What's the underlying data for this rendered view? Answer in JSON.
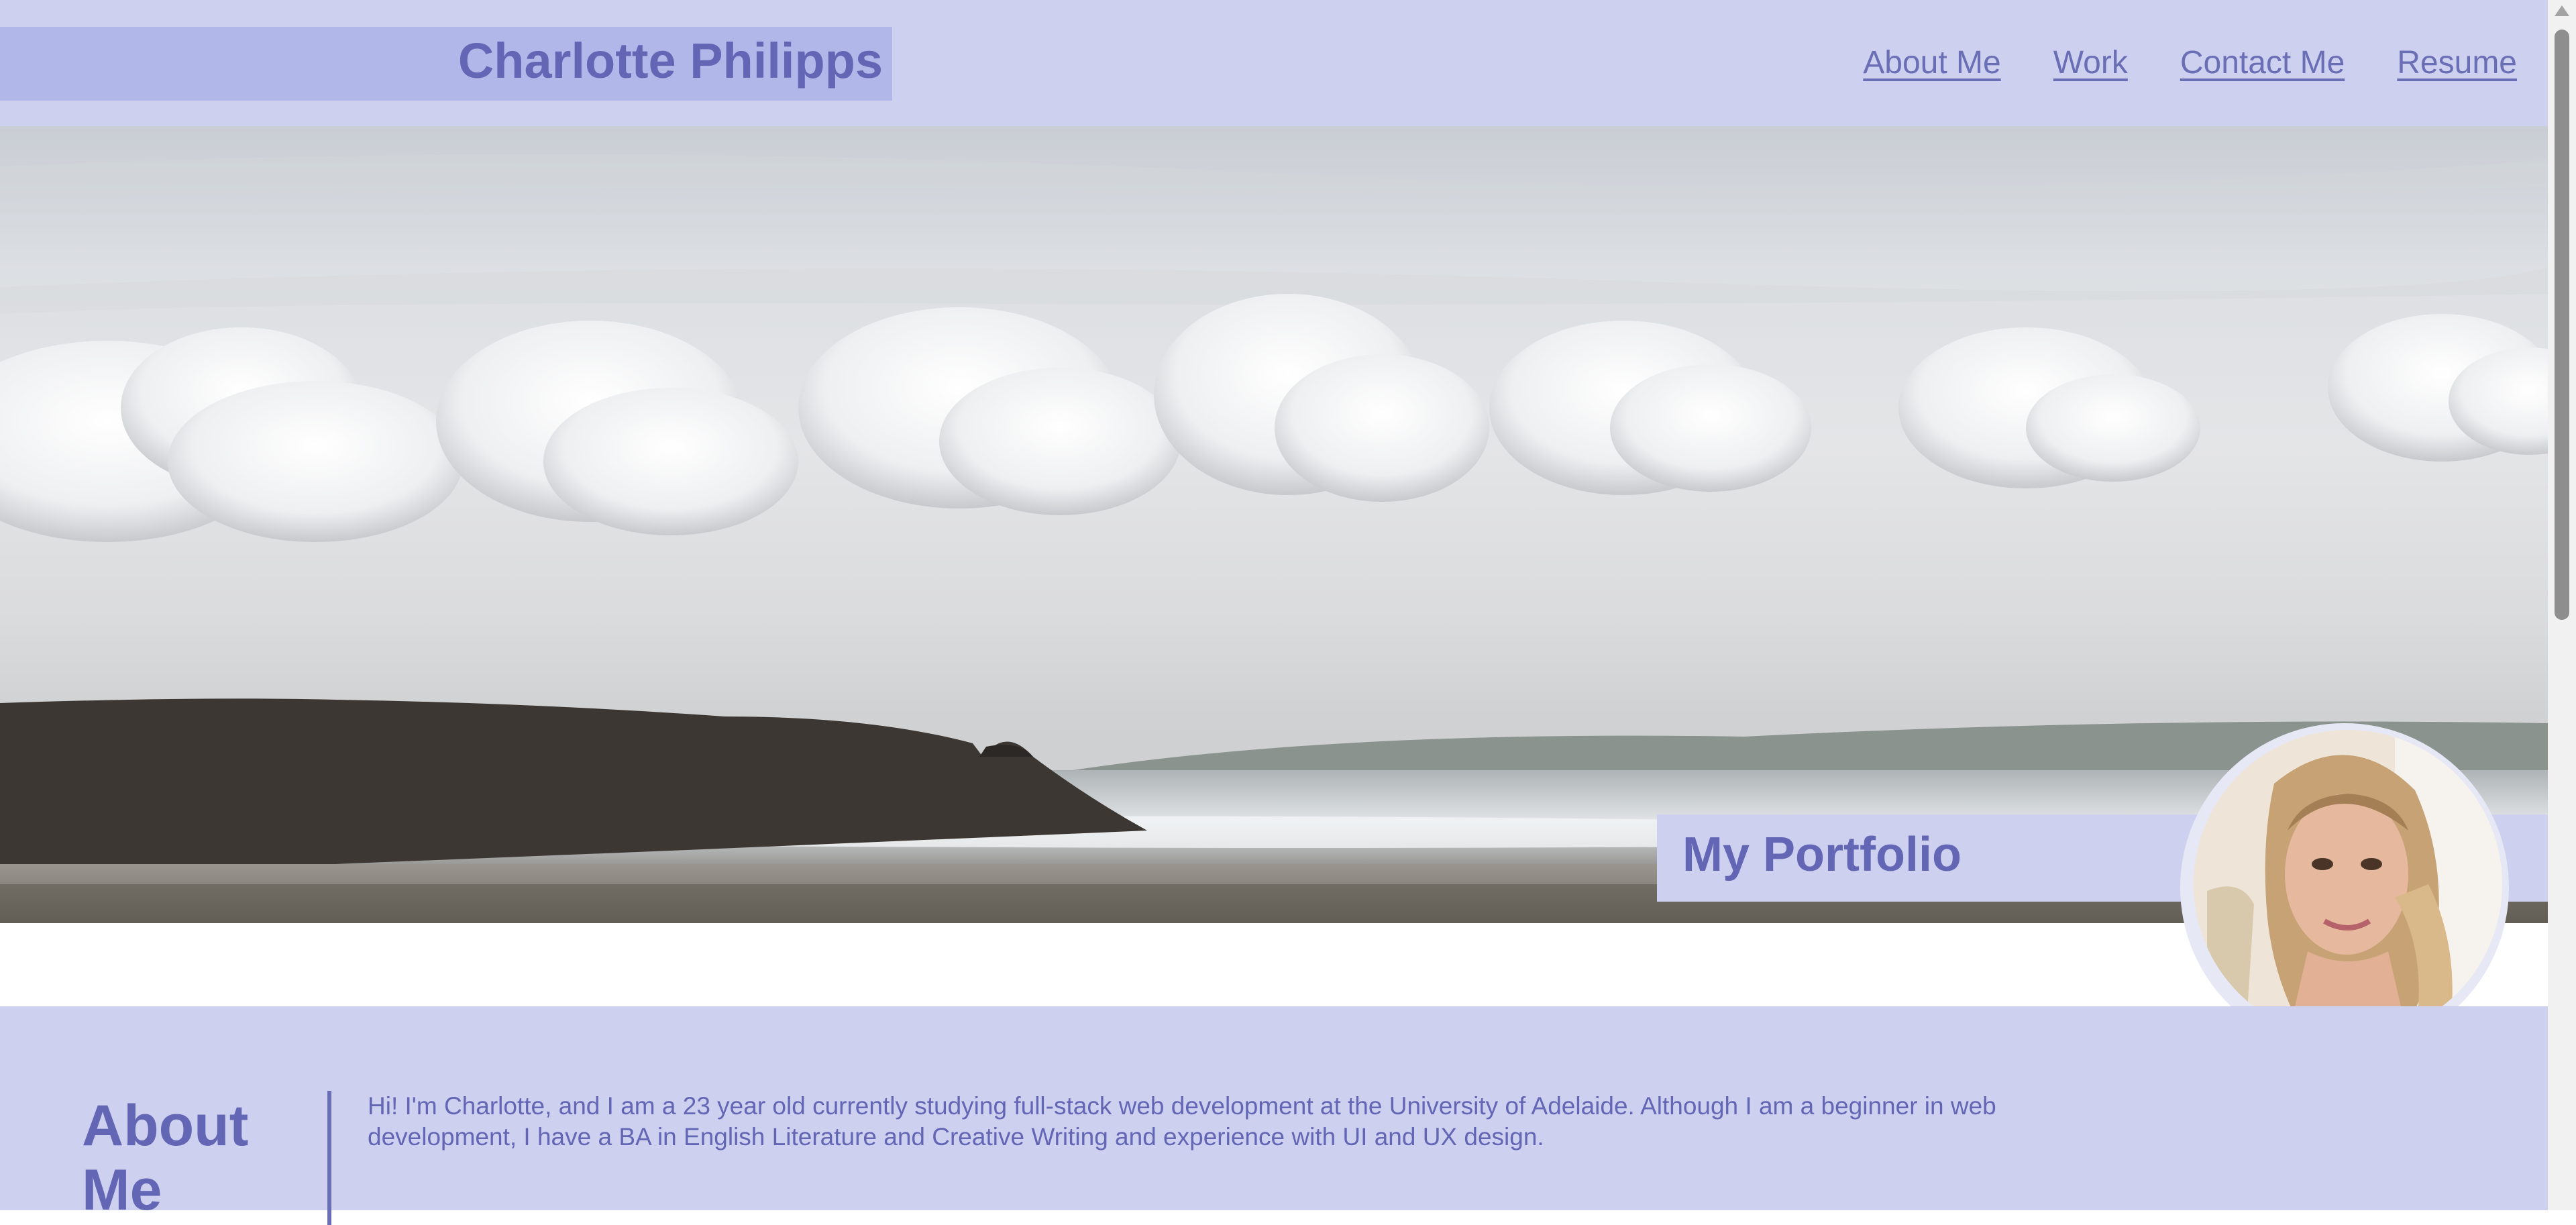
{
  "header": {
    "brand": "Charlotte Philipps",
    "nav": [
      {
        "label": "About Me"
      },
      {
        "label": "Work"
      },
      {
        "label": "Contact Me"
      },
      {
        "label": "Resume"
      }
    ]
  },
  "hero": {
    "image": "beach-landscape-with-clouds",
    "title": "My Portfolio",
    "avatar": "profile-photo"
  },
  "about": {
    "heading": "About Me",
    "text": "Hi! I'm Charlotte, and I am a 23 year old currently studying full-stack web development at the University of Adelaide. Although I am a beginner in web development, I have a BA in English Literature and Creative Writing and experience with UI and UX design."
  },
  "colors": {
    "accent": "#6366b5",
    "header_bg": "#cdd0ef",
    "brand_bg": "#b1b7e8"
  }
}
